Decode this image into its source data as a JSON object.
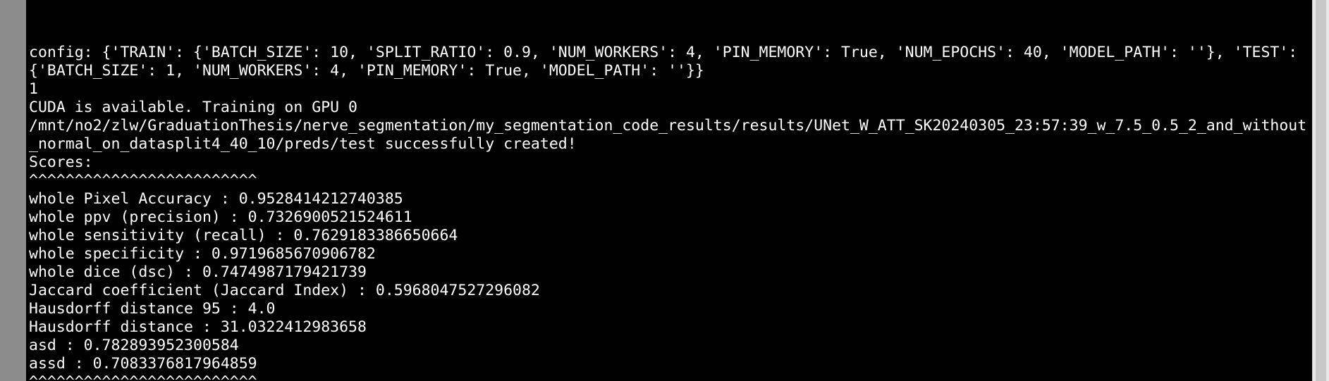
{
  "terminal": {
    "lines": [
      "config: {'TRAIN': {'BATCH_SIZE': 10, 'SPLIT_RATIO': 0.9, 'NUM_WORKERS': 4, 'PIN_MEMORY': True, 'NUM_EPOCHS': 40, 'MODEL_PATH': ''}, 'TEST':",
      "{'BATCH_SIZE': 1, 'NUM_WORKERS': 4, 'PIN_MEMORY': True, 'MODEL_PATH': ''}}",
      "1",
      "CUDA is available. Training on GPU 0",
      "/mnt/no2/zlw/GraduationThesis/nerve_segmentation/my_segmentation_code_results/results/UNet_W_ATT_SK20240305_23:57:39_w_7.5_0.5_2_and_without",
      "_normal_on_datasplit4_40_10/preds/test successfully created!",
      "Scores:",
      "^^^^^^^^^^^^^^^^^^^^^^^^^",
      "whole Pixel Accuracy : 0.9528414212740385",
      "whole ppv (precision) : 0.7326900521524611",
      "whole sensitivity (recall) : 0.7629183386650664",
      "whole specificity : 0.9719685670906782",
      "whole dice (dsc) : 0.7474987179421739",
      "Jaccard coefficient (Jaccard Index) : 0.5968047527296082",
      "Hausdorff distance 95 : 4.0",
      "Hausdorff distance : 31.0322412983658",
      "asd : 0.782893952300584",
      "assd : 0.7083376817964859",
      "^^^^^^^^^^^^^^^^^^^^^^^^^"
    ]
  }
}
